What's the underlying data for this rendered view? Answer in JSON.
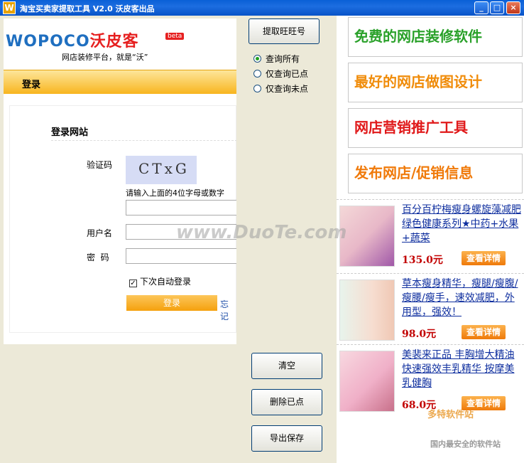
{
  "window": {
    "title": "淘宝买卖家提取工具 V2.0 沃皮客出品",
    "icon_letter": "W"
  },
  "left": {
    "logo_text": "WOPOCO",
    "logo_cn": "沃皮客",
    "beta": "beta",
    "slogan": "网店装修平台，就是“沃”",
    "login_tab": "登录",
    "site_title": "登录网站",
    "captcha_label": "验证码",
    "captcha_text": "CTxG",
    "captcha_hint": "请输入上面的4位字母或数字",
    "username_label": "用户名",
    "password_label": "密  码",
    "auto_login": "下次自动登录",
    "login_button": "登录",
    "forget": "忘记"
  },
  "middle": {
    "extract_button": "提取旺旺号",
    "radios": [
      {
        "label": "查询所有",
        "checked": true
      },
      {
        "label": "仅查询已点",
        "checked": false
      },
      {
        "label": "仅查询未点",
        "checked": false
      }
    ],
    "clear_button": "清空",
    "delete_button": "删除已点",
    "export_button": "导出保存"
  },
  "right": {
    "banners": [
      {
        "text": "免费的网店装修软件",
        "color": "#2aa12a"
      },
      {
        "text": "最好的网店做图设计",
        "color": "#f08c0a"
      },
      {
        "text": "网店营销推广工具",
        "color": "#e0191a"
      },
      {
        "text": "发布网店/促销信息",
        "color": "#f07a0a"
      }
    ],
    "ads": [
      {
        "title": "百分百柠梅瘦身螺旋藻减肥绿色健康系列★中药+水果+蔬菜",
        "price": "135.0元",
        "button": "查看详情"
      },
      {
        "title": "草本瘦身精华，瘦腿/瘦腹/瘦腰/瘦手，速效减肥，外用型，强效！",
        "price": "98.0元",
        "button": "查看详情"
      },
      {
        "title": "美裴来正品 丰胸增大精油 快速强效丰乳精华 按摩美乳健胸",
        "price": "68.0元",
        "button": "查看详情"
      }
    ]
  },
  "watermarks": {
    "main": "www.DuoTe.com",
    "site": "多特软件站",
    "tagline": "国内最安全的软件站"
  }
}
